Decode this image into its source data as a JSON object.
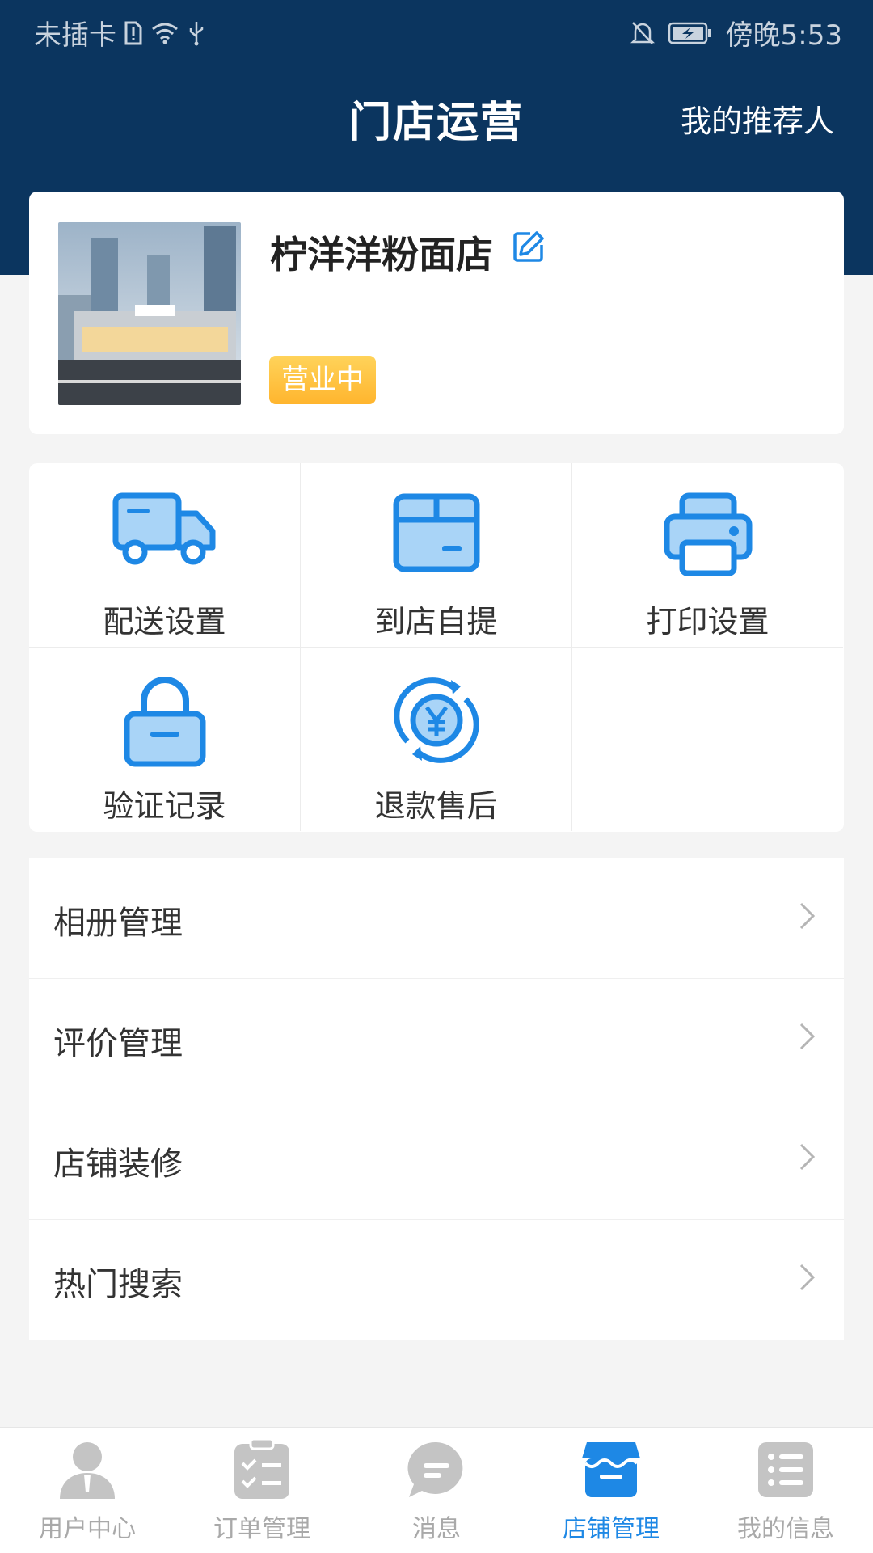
{
  "status_bar": {
    "carrier": "未插卡",
    "time": "傍晚5:53"
  },
  "header": {
    "title": "门店运营",
    "right_link": "我的推荐人"
  },
  "store": {
    "name": "柠洋洋粉面店",
    "status": "营业中"
  },
  "services": [
    {
      "label": "配送设置",
      "icon": "delivery-truck-icon"
    },
    {
      "label": "到店自提",
      "icon": "box-icon"
    },
    {
      "label": "打印设置",
      "icon": "printer-icon"
    },
    {
      "label": "验证记录",
      "icon": "lock-icon"
    },
    {
      "label": "退款售后",
      "icon": "refund-yen-icon"
    }
  ],
  "menu": [
    {
      "label": "相册管理"
    },
    {
      "label": "评价管理"
    },
    {
      "label": "店铺装修"
    },
    {
      "label": "热门搜索"
    }
  ],
  "tabbar": [
    {
      "label": "用户中心",
      "icon": "user-icon",
      "active": false
    },
    {
      "label": "订单管理",
      "icon": "clipboard-check-icon",
      "active": false
    },
    {
      "label": "消息",
      "icon": "message-bubble-icon",
      "active": false
    },
    {
      "label": "店铺管理",
      "icon": "store-icon",
      "active": true
    },
    {
      "label": "我的信息",
      "icon": "list-icon",
      "active": false
    }
  ],
  "colors": {
    "header_bg": "#0b355f",
    "accent": "#1e88e5",
    "icon_fill": "#a9d4f7",
    "badge": "#ffc043",
    "tab_inactive": "#a9a9a9"
  }
}
